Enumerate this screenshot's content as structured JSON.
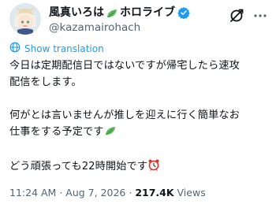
{
  "author": {
    "display_name": "風真いろは",
    "affiliation": "ホロライブ",
    "handle": "@kazamairohach",
    "verified": true
  },
  "translate_link": "Show translation",
  "tweet": {
    "line1": "今日は定期配信日ではないですが帰宅したら速攻",
    "line2": "配信をします。",
    "line3": "何がとは言いませんが推しを迎えに行く簡単なお",
    "line4": "仕事をする予定です",
    "line5": "どう頑張っても22時開始です"
  },
  "meta": {
    "time": "11:24 AM",
    "date": "Aug 7, 2026",
    "views_count": "217.4K",
    "views_label": "Views"
  },
  "icons": {
    "leaf": "leaf-icon",
    "verified": "verified-badge-icon",
    "grok": "grok-icon",
    "more": "more-icon",
    "globe": "globe-icon",
    "sprout": "sprout-emoji-icon",
    "clock": "alarm-clock-emoji-icon"
  },
  "colors": {
    "accent": "#1d9bf0",
    "muted": "#536471",
    "text": "#0f1419"
  }
}
